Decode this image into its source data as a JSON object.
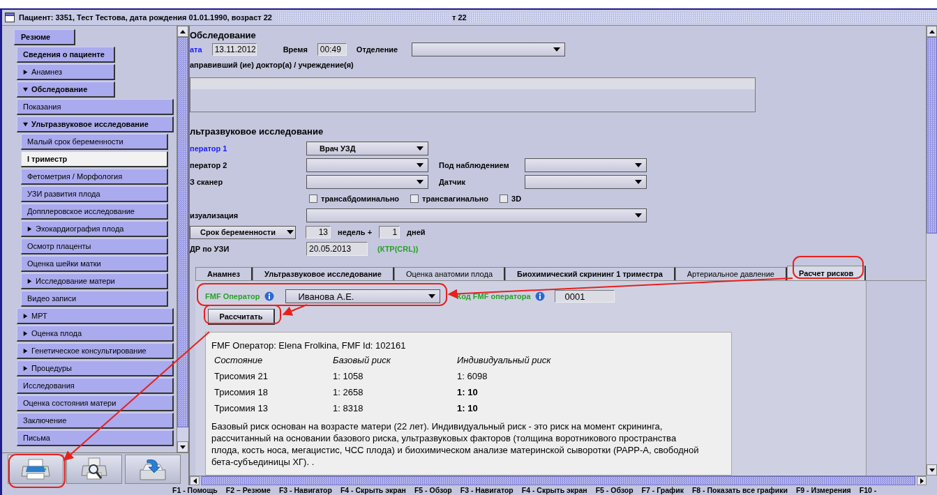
{
  "window": {
    "title": "Пациент:  3351, Тест Тестова, дата рождения 01.01.1990, возраст 22",
    "title_fragment": "т 22"
  },
  "sidebar": {
    "summary_button": "Резюме",
    "items": [
      {
        "label": "Сведения о пациенте",
        "emphasized": true,
        "selected": false
      },
      {
        "label": "Анамнез",
        "emphasized": false,
        "selected": false,
        "expanded": false
      },
      {
        "label": "Обследование",
        "emphasized": true,
        "selected": false,
        "expanded": true,
        "children": [
          {
            "label": "Показания",
            "emphasized": false,
            "selected": false
          },
          {
            "label": "Ультразвуковое исследование",
            "emphasized": true,
            "selected": false,
            "expanded": true,
            "children": [
              {
                "label": "Малый срок беременности",
                "emphasized": false,
                "selected": false
              },
              {
                "label": "I триместр",
                "emphasized": true,
                "selected": true
              },
              {
                "label": "Фетометрия / Морфология",
                "emphasized": false,
                "selected": false
              },
              {
                "label": "УЗИ развития плода",
                "emphasized": false,
                "selected": false
              },
              {
                "label": "Допплеровское исследование",
                "emphasized": false,
                "selected": false
              },
              {
                "label": "Эхокардиография плода",
                "emphasized": false,
                "selected": false,
                "expanded": false
              },
              {
                "label": "Осмотр плаценты",
                "emphasized": false,
                "selected": false
              },
              {
                "label": "Оценка шейки матки",
                "emphasized": false,
                "selected": false
              },
              {
                "label": "Исследование матери",
                "emphasized": false,
                "selected": false,
                "expanded": false
              },
              {
                "label": "Видео записи",
                "emphasized": false,
                "selected": false
              }
            ]
          },
          {
            "label": "МРТ",
            "emphasized": false,
            "selected": false,
            "expanded": false
          },
          {
            "label": "Оценка плода",
            "emphasized": false,
            "selected": false,
            "expanded": false
          },
          {
            "label": "Генетическое консультирование",
            "emphasized": false,
            "selected": false,
            "expanded": false
          },
          {
            "label": "Процедуры",
            "emphasized": false,
            "selected": false,
            "expanded": false
          },
          {
            "label": "Исследования",
            "emphasized": false,
            "selected": false
          },
          {
            "label": "Оценка состояния матери",
            "emphasized": false,
            "selected": false
          },
          {
            "label": "Заключение",
            "emphasized": false,
            "selected": false
          },
          {
            "label": "Письма",
            "emphasized": false,
            "selected": false
          }
        ]
      }
    ]
  },
  "toolbar": [
    {
      "kind": "print"
    },
    {
      "kind": "preview"
    },
    {
      "kind": "save"
    }
  ],
  "exam": {
    "heading": "Обследование",
    "date": {
      "label": "ата",
      "value": "13.11.2012",
      "required": true
    },
    "time": {
      "label": "Время",
      "value": "00:49",
      "required": false
    },
    "department": {
      "label": "Отделение",
      "required": false
    },
    "referrer": {
      "label": "аправивший (ие) доктор(а) / учреждение(я)"
    }
  },
  "ultrasound": {
    "heading": "льтразвуковое исследование",
    "operator1": {
      "label": "ператор 1",
      "value": "Врач УЗД",
      "required": true
    },
    "operator2": {
      "label": "ператор 2",
      "required": false
    },
    "observed": {
      "label": "Под наблюдением",
      "required": false
    },
    "scanner": {
      "label": "З сканер",
      "required": false
    },
    "probe": {
      "label": "Датчик",
      "required": false
    },
    "checkboxes": [
      {
        "label": "трансабдоминально",
        "checked": false
      },
      {
        "label": "трансвагинально",
        "checked": false
      },
      {
        "label": "3D",
        "checked": false
      }
    ],
    "visualization": {
      "label": "изуализация",
      "required": false
    },
    "term": {
      "button": "Срок беременности",
      "weeks": "13",
      "weeks_label": "недель +",
      "days": "1",
      "days_label": "дней"
    },
    "edd": {
      "label": "ДР по УЗИ",
      "value": "20.05.2013",
      "method": "(КТР(CRL))"
    }
  },
  "tabs": [
    {
      "label": "Анамнез",
      "has_data": true,
      "selected": false
    },
    {
      "label": "Ультразвуковое исследование",
      "has_data": true,
      "selected": false
    },
    {
      "label": "Оценка анатомии плода",
      "has_data": false,
      "selected": false
    },
    {
      "label": "Биохимический скрининг 1 триместра",
      "has_data": true,
      "selected": false
    },
    {
      "label": "Артериальное давление",
      "has_data": false,
      "selected": false
    },
    {
      "label": "Расчет рисков",
      "has_data": true,
      "selected": true
    }
  ],
  "risk": {
    "operator_label": "FMF Оператор",
    "operator_value": "Иванова А.Е.",
    "code_label": "Код FMF оператора",
    "code_value": "0001",
    "calculate_button": "Рассчитать",
    "result": {
      "header": "FMF Оператор: Elena Frolkina, FMF Id: 102161",
      "columns": [
        "Состояние",
        "Базовый риск",
        "Индивидуальный риск"
      ],
      "rows": [
        {
          "condition": "Трисомия 21",
          "base": "1: 1058",
          "individual": "1: 6098",
          "high_risk": false
        },
        {
          "condition": "Трисомия 18",
          "base": "1: 2658",
          "individual": "1: 10",
          "high_risk": true
        },
        {
          "condition": "Трисомия 13",
          "base": "1: 8318",
          "individual": "1: 10",
          "high_risk": true
        }
      ],
      "note": "Базовый риск основан на возрасте матери (22 лет). Индивидуальный риск - это риск на момент скрининга, рассчитанный на основании базового риска, ультразвуковых факторов (толщина воротникового пространства плода, кость носа, мегацистис, ЧСС плода) и биохимическом анализе материнской сыворотки (PAPP-A, свободной бета-субъединицы ХГ). ."
    }
  },
  "status_bar": [
    "F1 - Помощь",
    "F2 – Резюме",
    "F3 - Навигатор",
    "F4 - Скрыть экран",
    "F5 - Обзор",
    "F3 - Навигатор",
    "F4 - Скрыть экран",
    "F5 - Обзор",
    "F7 - График",
    "F8 - Показать все графики",
    "F9 - Измерения",
    "F10 -"
  ]
}
